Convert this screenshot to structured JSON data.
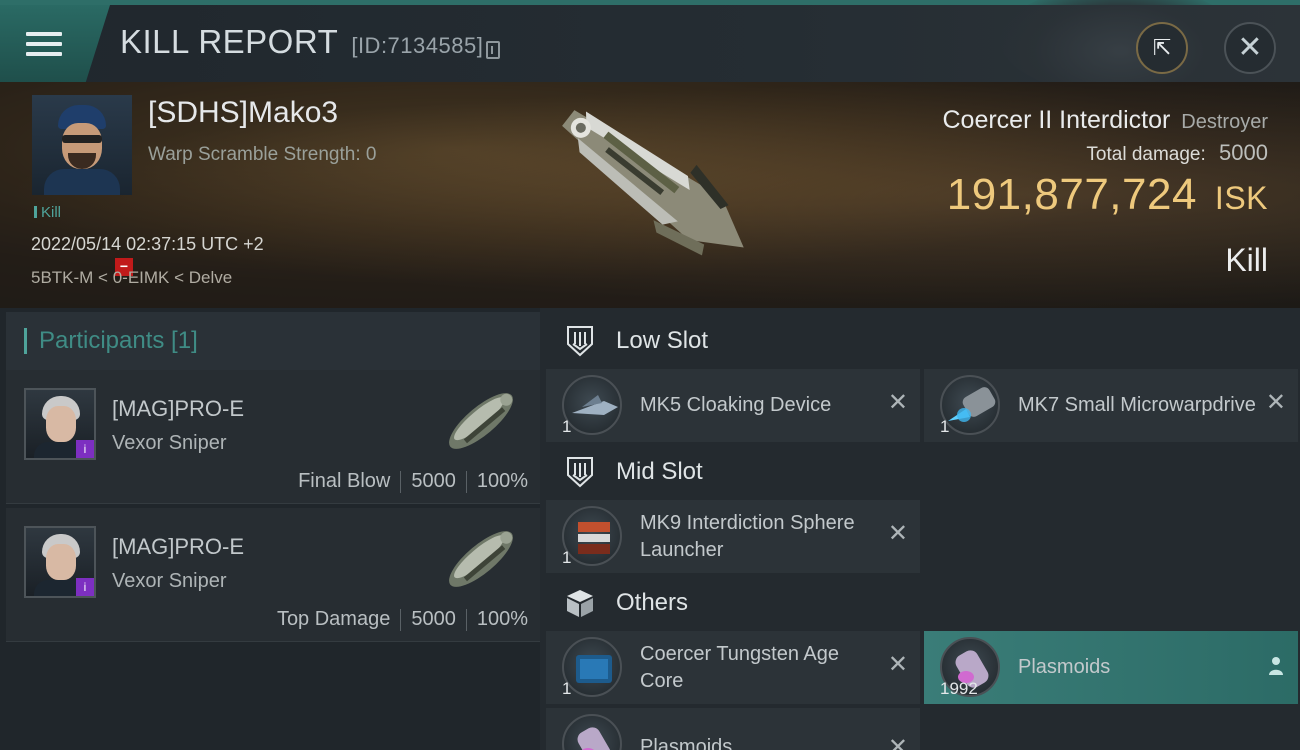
{
  "header": {
    "title": "KILL REPORT",
    "report_id": "[ID:7134585]"
  },
  "victim": {
    "name": "[SDHS]Mako3",
    "warp_scramble": "Warp Scramble Strength: 0",
    "tag": "Kill",
    "datetime": "2022/05/14 02:37:15 UTC +2",
    "location": "5BTK-M < 0-EIMK < Delve",
    "ship_name": "Coercer II Interdictor",
    "ship_class": "Destroyer",
    "total_damage_label": "Total damage:",
    "total_damage": "5000",
    "isk_value": "191,877,724",
    "isk_unit": "ISK",
    "result": "Kill"
  },
  "participants": {
    "header": "Participants [1]",
    "items": [
      {
        "name": "[MAG]PRO-E",
        "ship": "Vexor Sniper",
        "role": "Final Blow",
        "damage": "5000",
        "percent": "100%"
      },
      {
        "name": "[MAG]PRO-E",
        "ship": "Vexor Sniper",
        "role": "Top Damage",
        "damage": "5000",
        "percent": "100%"
      }
    ]
  },
  "fitting": {
    "low_slot": {
      "label": "Low Slot",
      "items": [
        {
          "qty": "1",
          "name": "MK5 Cloaking Device"
        },
        {
          "qty": "1",
          "name": "MK7 Small Microwarpdrive"
        }
      ]
    },
    "mid_slot": {
      "label": "Mid Slot",
      "items": [
        {
          "qty": "1",
          "name": "MK9 Interdiction Sphere Launcher"
        }
      ]
    },
    "others": {
      "label": "Others",
      "items": [
        {
          "qty": "1",
          "name": "Coercer Tungsten Age Core"
        },
        {
          "qty": "1992",
          "name": "Plasmoids"
        },
        {
          "qty": "",
          "name": "Plasmoids"
        }
      ]
    }
  },
  "colors": {
    "accent_teal": "#4fa49b",
    "isk_gold": "#eec97d",
    "highlight_item": "#3a7d78",
    "negative_badge": "#c11a1a",
    "corp_badge": "#7d2fc1"
  }
}
